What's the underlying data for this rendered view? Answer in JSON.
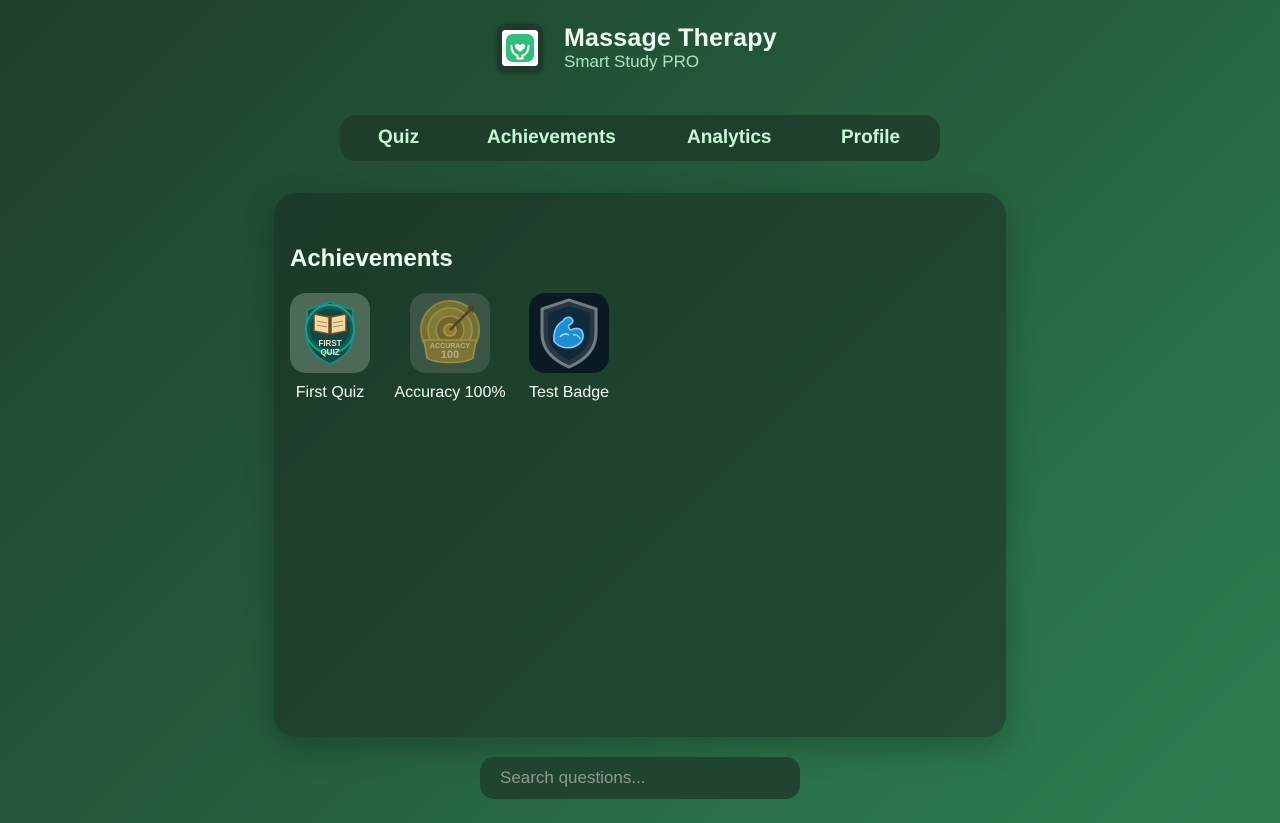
{
  "app": {
    "title": "Massage Therapy",
    "subtitle": "Smart Study PRO",
    "icon": "hands-heart-icon"
  },
  "nav": {
    "items": [
      {
        "label": "Quiz"
      },
      {
        "label": "Achievements"
      },
      {
        "label": "Analytics"
      },
      {
        "label": "Profile"
      }
    ]
  },
  "achievements": {
    "title": "Achievements",
    "badges": [
      {
        "label": "First Quiz",
        "icon": "open-book-badge-icon",
        "emblem_text": [
          "FIRST",
          "QUIZ"
        ]
      },
      {
        "label": "Accuracy 100%",
        "icon": "target-arrow-badge-icon",
        "emblem_text": [
          "ACCURACY",
          "100"
        ]
      },
      {
        "label": "Test Badge",
        "icon": "flexed-arm-shield-icon"
      }
    ]
  },
  "search": {
    "placeholder": "Search questions...",
    "value": ""
  },
  "colors": {
    "accent": "#2fbf7a",
    "nav_text": "#c9f7d6",
    "subtitle": "#a9e6bf"
  }
}
